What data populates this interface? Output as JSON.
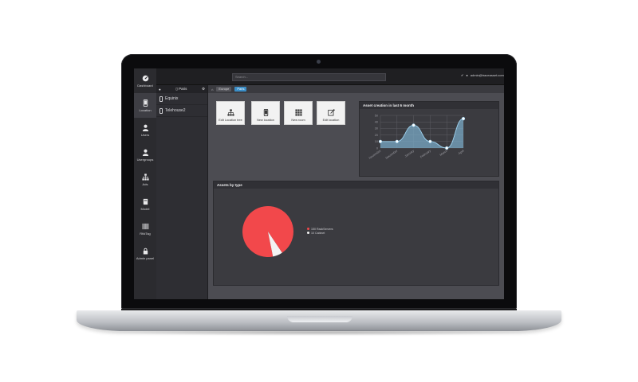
{
  "sidebar": {
    "items": [
      {
        "label": "Dashboard",
        "icon": "dashboard-icon"
      },
      {
        "label": "Location",
        "icon": "phone-location-icon"
      },
      {
        "label": "Users",
        "icon": "user-icon"
      },
      {
        "label": "Usergroups",
        "icon": "usergroup-icon"
      },
      {
        "label": "Ads",
        "icon": "hierarchy-icon"
      },
      {
        "label": "Model",
        "icon": "book-icon"
      },
      {
        "label": "RfidTag",
        "icon": "barcode-icon"
      },
      {
        "label": "Admin panel",
        "icon": "lock-icon"
      }
    ]
  },
  "topbar": {
    "search_placeholder": "Search...",
    "user_label": "admin@traceasset.com"
  },
  "tree": {
    "title": "Paris",
    "items": [
      "Equinix",
      "Telehouse2"
    ]
  },
  "breadcrumb": {
    "items": [
      "Europe",
      "Paris"
    ]
  },
  "actions": {
    "edit_tree": "Edit Location tree",
    "new_location": "New location",
    "new_room": "New room",
    "edit_location": "Edit location"
  },
  "asset_chart": {
    "title": "Asset creation in last 6 month",
    "chart_data": {
      "type": "area",
      "categories": [
        "November",
        "December",
        "January",
        "February",
        "March",
        "April"
      ],
      "values": [
        10,
        10,
        35,
        10,
        0,
        45
      ],
      "ylim": [
        0,
        50
      ],
      "yticks": [
        0,
        10,
        20,
        30,
        40,
        50
      ],
      "grid": true,
      "line_color": "#9fd3f0",
      "fill_color": "#7aa9c5"
    }
  },
  "assets_by_type": {
    "title": "Assets by type",
    "chart_data": {
      "type": "pie",
      "slices": [
        {
          "name": "150 RackServers",
          "value": 150,
          "color": "#f2484b"
        },
        {
          "name": "10 Cabinet",
          "value": 10,
          "color": "#f3f3f3"
        }
      ]
    }
  }
}
